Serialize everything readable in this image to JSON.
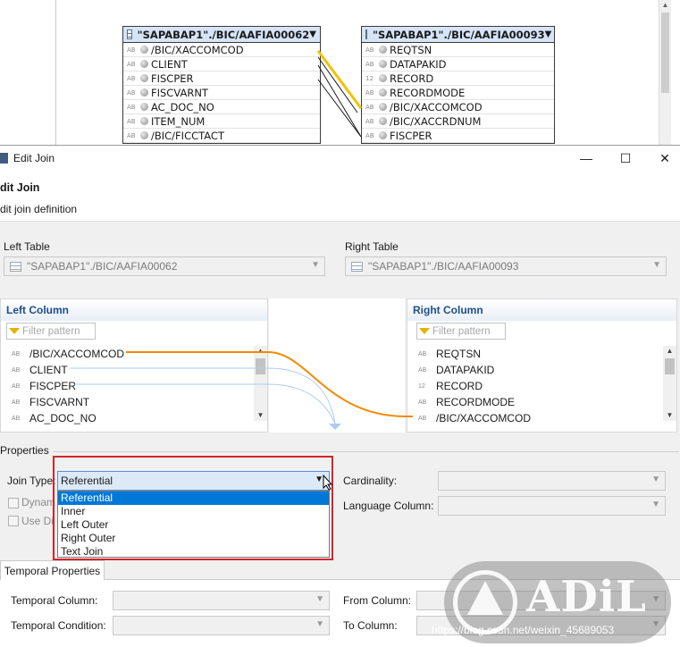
{
  "diagram": {
    "left_table": {
      "name": "\"SAPABAP1\"./BIC/AAFIA00062",
      "rows": [
        {
          "type": "AB",
          "name": "/BIC/XACCOMCOD"
        },
        {
          "type": "AB",
          "name": "CLIENT"
        },
        {
          "type": "AB",
          "name": "FISCPER"
        },
        {
          "type": "AB",
          "name": "FISCVARNT"
        },
        {
          "type": "AB",
          "name": "AC_DOC_NO"
        },
        {
          "type": "AB",
          "name": "ITEM_NUM"
        },
        {
          "type": "AB",
          "name": "/BIC/FICCTACT"
        }
      ]
    },
    "right_table": {
      "name": "\"SAPABAP1\"./BIC/AAFIA00093",
      "rows": [
        {
          "type": "AB",
          "name": "REQTSN"
        },
        {
          "type": "AB",
          "name": "DATAPAKID"
        },
        {
          "type": "12",
          "name": "RECORD"
        },
        {
          "type": "AB",
          "name": "RECORDMODE"
        },
        {
          "type": "AB",
          "name": "/BIC/XACCOMCOD"
        },
        {
          "type": "AB",
          "name": "/BIC/XACCRDNUM"
        },
        {
          "type": "AB",
          "name": "FISCPER"
        }
      ]
    },
    "join_line_color": "#f2c200"
  },
  "dialog": {
    "window_title": "Edit Join",
    "header_title": "dit Join",
    "header_subtitle": "dit join definition",
    "left_table_label": "Left Table",
    "left_table_value": "\"SAPABAP1\"./BIC/AAFIA00062",
    "right_table_label": "Right Table",
    "right_table_value": "\"SAPABAP1\"./BIC/AAFIA00093",
    "left_column": {
      "title": "Left Column",
      "filter_placeholder": "Filter pattern",
      "rows": [
        {
          "type": "AB",
          "name": "/BIC/XACCOMCOD"
        },
        {
          "type": "AB",
          "name": "CLIENT"
        },
        {
          "type": "AB",
          "name": "FISCPER"
        },
        {
          "type": "AB",
          "name": "FISCVARNT"
        },
        {
          "type": "AB",
          "name": "AC_DOC_NO"
        }
      ]
    },
    "right_column": {
      "title": "Right Column",
      "filter_placeholder": "Filter pattern",
      "rows": [
        {
          "type": "AB",
          "name": "REQTSN"
        },
        {
          "type": "AB",
          "name": "DATAPAKID"
        },
        {
          "type": "12",
          "name": "RECORD"
        },
        {
          "type": "AB",
          "name": "RECORDMODE"
        },
        {
          "type": "AB",
          "name": "/BIC/XACCOMCOD"
        }
      ]
    },
    "mapping_line_color": "#f28a00",
    "mapping_line_secondary_color": "#a9cdf0",
    "properties_label": "Properties",
    "join_type_label": "Join Type:",
    "join_type_value": "Referential",
    "join_type_options": [
      "Referential",
      "Inner",
      "Left Outer",
      "Right Outer",
      "Text Join"
    ],
    "join_type_selected_index": 0,
    "dynamic_join_label": "Dynam",
    "use_label": "Use Di",
    "cardinality_label": "Cardinality:",
    "cardinality_value": "",
    "language_column_label": "Language Column:",
    "language_column_value": "",
    "temporal_tab_label": "Temporal Properties",
    "temporal_column_label": "Temporal Column:",
    "temporal_condition_label": "Temporal Condition:",
    "from_column_label": "From Column:",
    "to_column_label": "To Column:",
    "highlight_color": "#d0262c"
  },
  "watermark": {
    "brand": "ADiL",
    "url": "https://blog.csdn.net/weixin_45689053"
  }
}
